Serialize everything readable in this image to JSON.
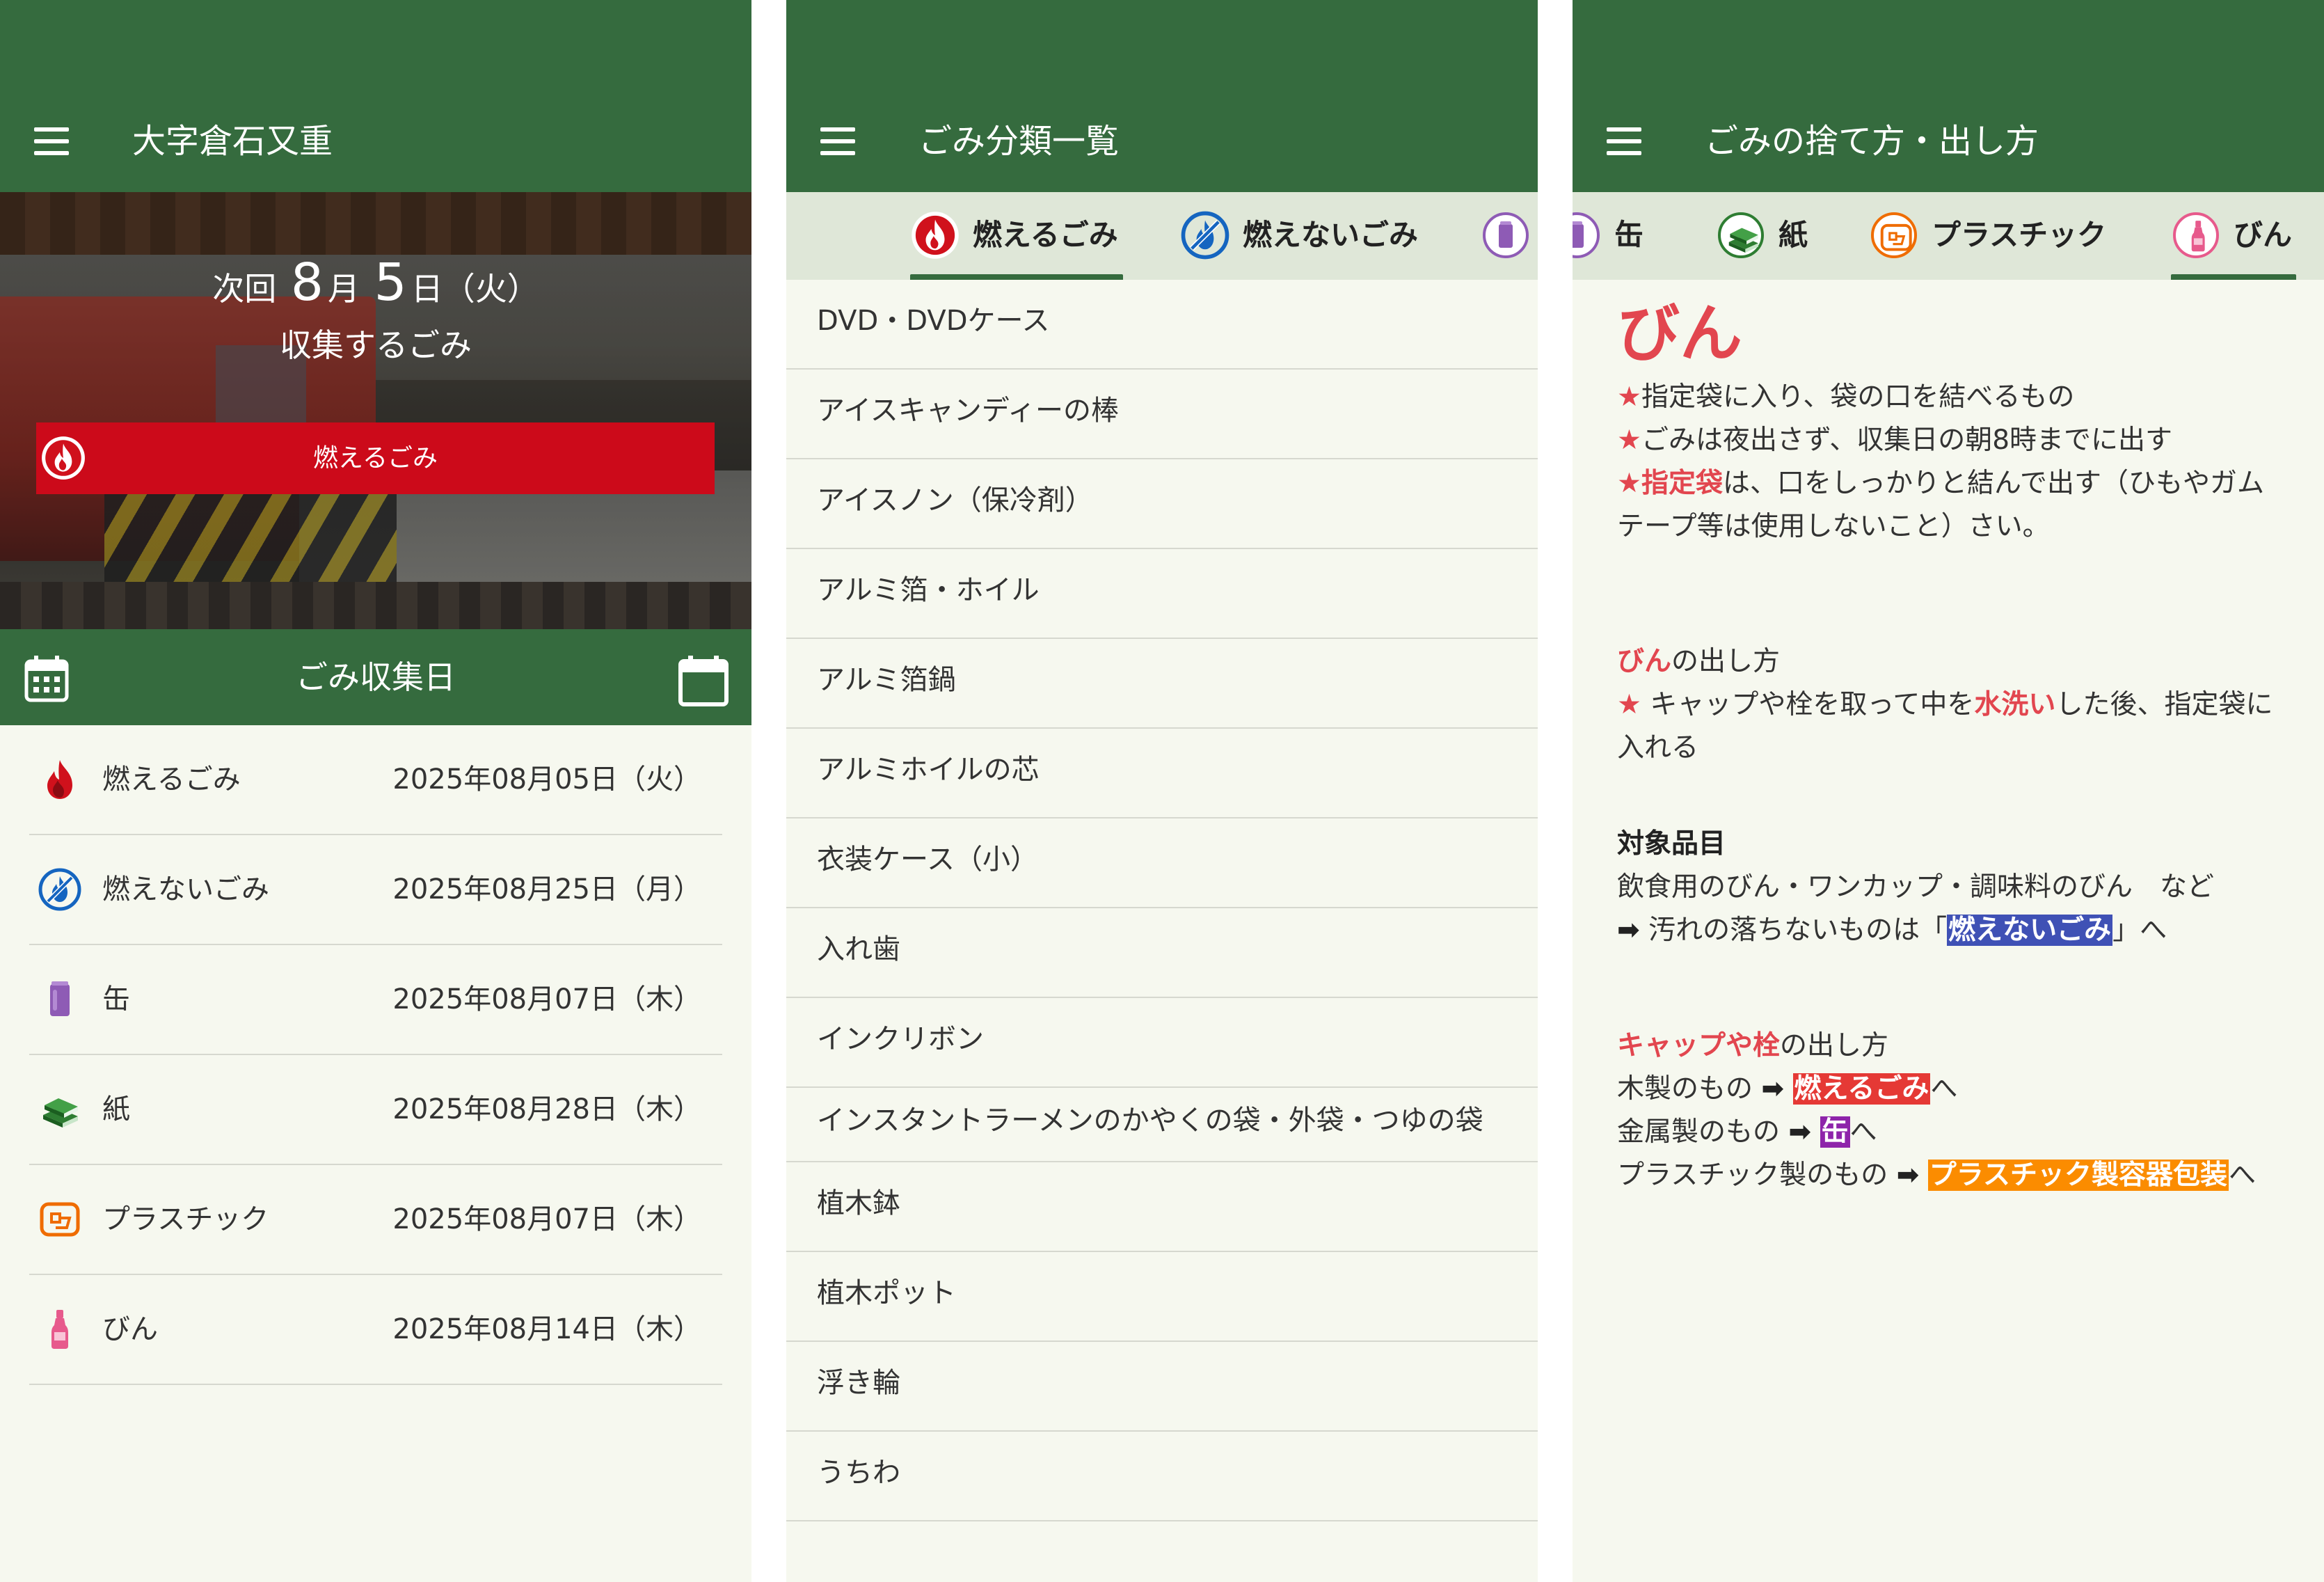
{
  "colors": {
    "appbar": "#356b3e",
    "background": "#f6f8ef",
    "tab_background": "#dfe7d8",
    "burnable": "#cc0a1a",
    "non_burnable": "#1565c0",
    "can": "#8e5bb5",
    "paper": "#2e7d32",
    "plastic": "#ef6c00",
    "bottle": "#e75a8c",
    "highlight_red": "#e2464f"
  },
  "home": {
    "title": "大字倉石又重",
    "next_prefix": "次回",
    "next_month": "8",
    "month_unit": "月",
    "next_day": "5",
    "day_unit": "日",
    "next_weekday": "（火）",
    "next_caption": "収集するごみ",
    "next_type": "燃えるごみ",
    "section_title": "ごみ収集日",
    "schedule": [
      {
        "name": "燃えるごみ",
        "date": "2025年08月05日（火）",
        "icon": "flame-icon"
      },
      {
        "name": "燃えないごみ",
        "date": "2025年08月25日（月）",
        "icon": "no-burn-icon"
      },
      {
        "name": "缶",
        "date": "2025年08月07日（木）",
        "icon": "can-icon"
      },
      {
        "name": "紙",
        "date": "2025年08月28日（木）",
        "icon": "paper-books-icon"
      },
      {
        "name": "プラスチック",
        "date": "2025年08月07日（木）",
        "icon": "plastic-icon"
      },
      {
        "name": "びん",
        "date": "2025年08月14日（木）",
        "icon": "bottle-icon"
      }
    ]
  },
  "classification": {
    "title": "ごみ分類一覧",
    "tabs": [
      {
        "label": "燃えるごみ",
        "icon": "flame-icon",
        "selected": true
      },
      {
        "label": "燃えないごみ",
        "icon": "no-burn-icon",
        "selected": false
      },
      {
        "label": "",
        "icon": "can-icon",
        "selected": false
      }
    ],
    "items": [
      "DVD・DVDケース",
      "アイスキャンディーの棒",
      "アイスノン（保冷剤）",
      "アルミ箔・ホイル",
      "アルミ箔鍋",
      "アルミホイルの芯",
      "衣装ケース（小）",
      "入れ歯",
      "インクリボン",
      "インスタントラーメンのかやくの袋・外袋・つゆの袋",
      "植木鉢",
      "植木ポット",
      "浮き輪",
      "うちわ"
    ]
  },
  "howto": {
    "title": "ごみの捨て方・出し方",
    "tabs": [
      {
        "label": "缶",
        "icon": "can-icon",
        "selected": false
      },
      {
        "label": "紙",
        "icon": "paper-books-icon",
        "selected": false
      },
      {
        "label": "プラスチック",
        "icon": "plastic-icon",
        "selected": false
      },
      {
        "label": "びん",
        "icon": "bottle-icon",
        "selected": true
      }
    ],
    "heading": "びん",
    "rule1": "指定袋に入り、袋の口を結べるもの",
    "rule2": "ごみは夜出さず、収集日の朝8時までに出す",
    "rule3_em": "指定袋",
    "rule3": "は、口をしっかりと結んで出す（ひもやガムテープ等は使用しないこと）さい。",
    "star": "★",
    "method_em": "びん",
    "method_suffix": "の出し方",
    "method_pre": " キャップや栓を取って中を",
    "method_wash": "水洗い",
    "method_post": "した後、指定袋に入れる",
    "target_title": "対象品目",
    "target_items": "飲食用のびん・ワンカップ・調味料のびん　など",
    "dirty_pre": "汚れの落ちないものは「",
    "dirty_link": "燃えないごみ",
    "dirty_post": "」へ",
    "cap_em": "キャップや栓",
    "cap_suffix": "の出し方",
    "wood_pre": "木製のもの",
    "wood_link": "燃えるごみ",
    "metal_pre": "金属製のもの",
    "metal_link": "缶",
    "plastic_pre": "プラスチック製のもの",
    "plastic_link": "プラスチック製容器包装",
    "to": "へ",
    "arrow": "➡"
  }
}
